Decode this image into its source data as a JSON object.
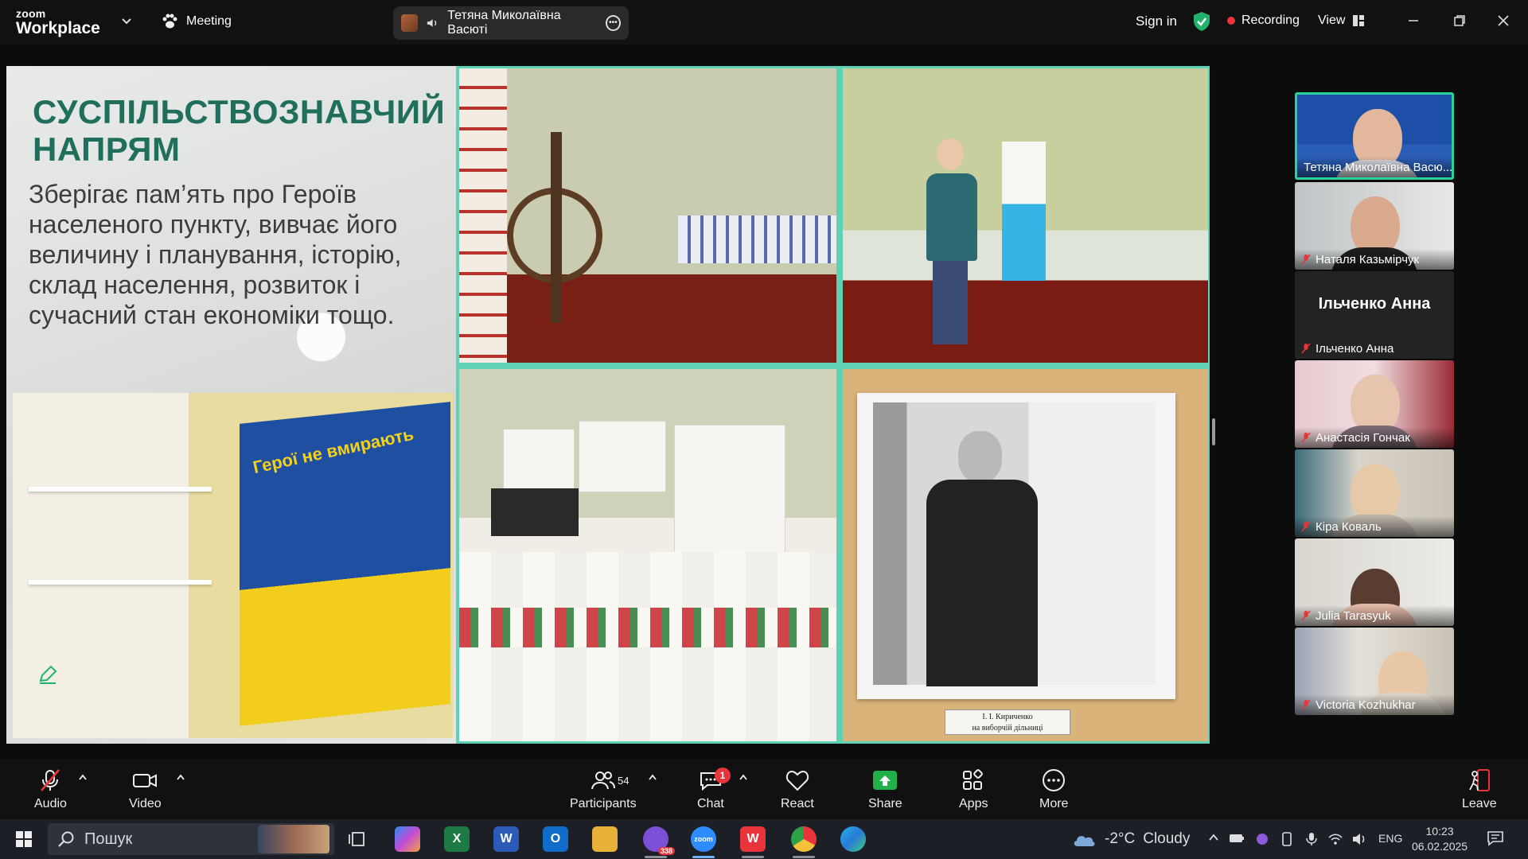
{
  "window": {
    "logo_line1": "zoom",
    "logo_line2": "Workplace",
    "meeting_label": "Meeting",
    "active_speaker": "Тетяна Миколаївна Васюті",
    "sign_in": "Sign in",
    "recording": "Recording",
    "view": "View",
    "accent_color": "#28d39a",
    "recording_color": "#e8343a"
  },
  "slide": {
    "title": "СУСПІЛЬСТВОЗНАВЧИЙ НАПРЯМ",
    "body": "Зберігає пам’ять про Героїв населеного пункту, вивчає його величину і планування, історію, склад населення, розвиток і сучасний стан економіки тощо.",
    "poster_text": "Герої не вмирають",
    "photo_caption_line1": "І. І. Кириченко",
    "photo_caption_line2": "на виборчій дільниці"
  },
  "participants": [
    {
      "name": "Тетяна Миколаївна Васю...",
      "muted": false,
      "active": true
    },
    {
      "name": "Наталя Казьмірчук",
      "muted": true
    },
    {
      "name": "Ільченко Анна",
      "muted": true,
      "video_off": true,
      "display_name": "Ільченко Анна"
    },
    {
      "name": "Анастасія Гончак",
      "muted": true
    },
    {
      "name": "Кіра Коваль",
      "muted": true
    },
    {
      "name": "Julia Tarasyuk",
      "muted": true
    },
    {
      "name": "Victoria Kozhukhar",
      "muted": true
    }
  ],
  "toolbar": {
    "audio": "Audio",
    "video": "Video",
    "participants": "Participants",
    "participants_count": "54",
    "chat": "Chat",
    "chat_badge": "1",
    "react": "React",
    "share": "Share",
    "apps": "Apps",
    "more": "More",
    "leave": "Leave"
  },
  "taskbar": {
    "search_placeholder": "Пошук",
    "viber_badge": "338",
    "weather_temp": "-2°C",
    "weather_desc": "Cloudy",
    "language": "ENG",
    "time": "10:23",
    "date": "06.02.2025"
  }
}
